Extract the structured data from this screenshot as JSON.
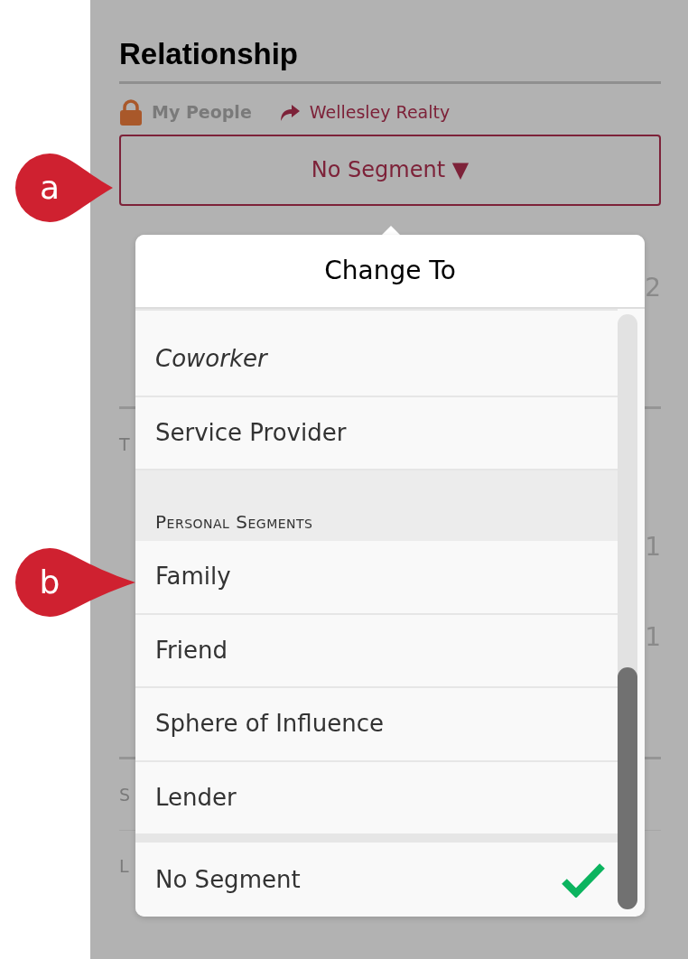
{
  "callouts": [
    {
      "label": "a"
    },
    {
      "label": "b"
    }
  ],
  "section": {
    "title": "Relationship",
    "owner": "My People",
    "shared_with": "Wellesley Realty"
  },
  "segment_button": {
    "label": "No Segment",
    "caret": "▼"
  },
  "background": [
    {
      "kind": "number",
      "text": "2"
    },
    {
      "kind": "rule"
    },
    {
      "kind": "label",
      "text": "T"
    },
    {
      "kind": "number",
      "text": "1"
    },
    {
      "kind": "number",
      "text": "1"
    },
    {
      "kind": "rule"
    },
    {
      "kind": "label",
      "text": "S"
    },
    {
      "kind": "thin-rule"
    },
    {
      "kind": "label",
      "text": "L"
    }
  ],
  "popover": {
    "title": "Change To",
    "items": [
      {
        "kind": "option",
        "label": "Coworker",
        "italic": true,
        "selected": false
      },
      {
        "kind": "option",
        "label": "Service Provider",
        "italic": false,
        "selected": false
      },
      {
        "kind": "header",
        "label": "Personal Segments"
      },
      {
        "kind": "option",
        "label": "Family",
        "italic": false,
        "selected": false
      },
      {
        "kind": "option",
        "label": "Friend",
        "italic": false,
        "selected": false
      },
      {
        "kind": "option",
        "label": "Sphere of Influence",
        "italic": false,
        "selected": false
      },
      {
        "kind": "option",
        "label": "Lender",
        "italic": false,
        "selected": false
      },
      {
        "kind": "spacer"
      },
      {
        "kind": "option",
        "label": "No Segment",
        "italic": false,
        "selected": true
      }
    ]
  }
}
